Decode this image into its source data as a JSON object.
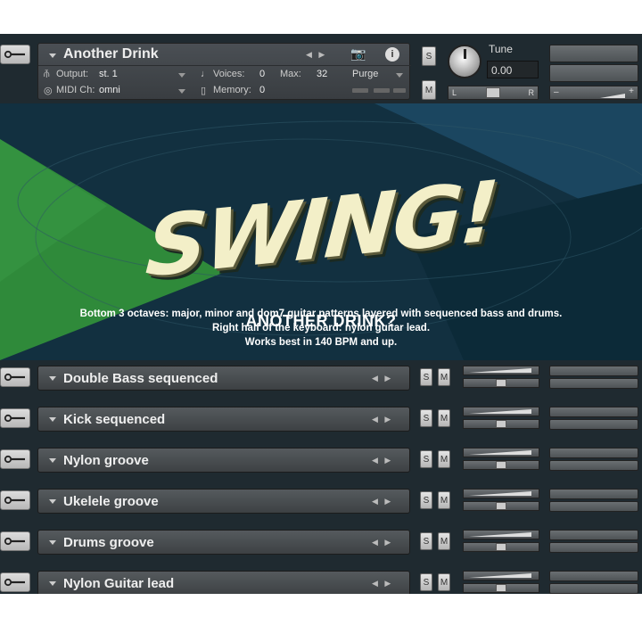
{
  "header": {
    "instrument_name": "Another Drink",
    "output_label": "Output:",
    "output_value": "st. 1",
    "voices_label": "Voices:",
    "voices_value": "0",
    "max_label": "Max:",
    "max_value": "32",
    "purge_label": "Purge",
    "midi_label": "MIDI Ch:",
    "midi_value": "omni",
    "memory_label": "Memory:",
    "memory_value": "0",
    "tune_label": "Tune",
    "tune_value": "0.00",
    "solo_label": "S",
    "mute_label": "M",
    "pan_left": "L",
    "pan_right": "R"
  },
  "hero": {
    "logo_text": "SWING!",
    "heading": "ANOTHER DRINK?",
    "lines": [
      "Bottom 3 octaves: major, minor and dom7 guitar patterns layered with sequenced bass and drums.",
      "Right half of the keyboard: nylon guitar lead.",
      "Works best in 140 BPM and up."
    ]
  },
  "rows": [
    {
      "label": "Double Bass sequenced",
      "solo": "S",
      "mute": "M"
    },
    {
      "label": "Kick sequenced",
      "solo": "S",
      "mute": "M"
    },
    {
      "label": "Nylon groove",
      "solo": "S",
      "mute": "M"
    },
    {
      "label": "Ukelele groove",
      "solo": "S",
      "mute": "M"
    },
    {
      "label": "Drums groove",
      "solo": "S",
      "mute": "M"
    },
    {
      "label": "Nylon Guitar lead",
      "solo": "S",
      "mute": "M"
    }
  ],
  "colors": {
    "background": "#1f2a30",
    "panel": "#454a4e",
    "hero_dark": "#123040",
    "hero_green": "#2f8a3a",
    "logo": "#f3efc8"
  },
  "icons": {
    "wrench": "wrench-icon",
    "camera": "camera-icon",
    "info": "info-icon",
    "knob": "tune-knob"
  }
}
